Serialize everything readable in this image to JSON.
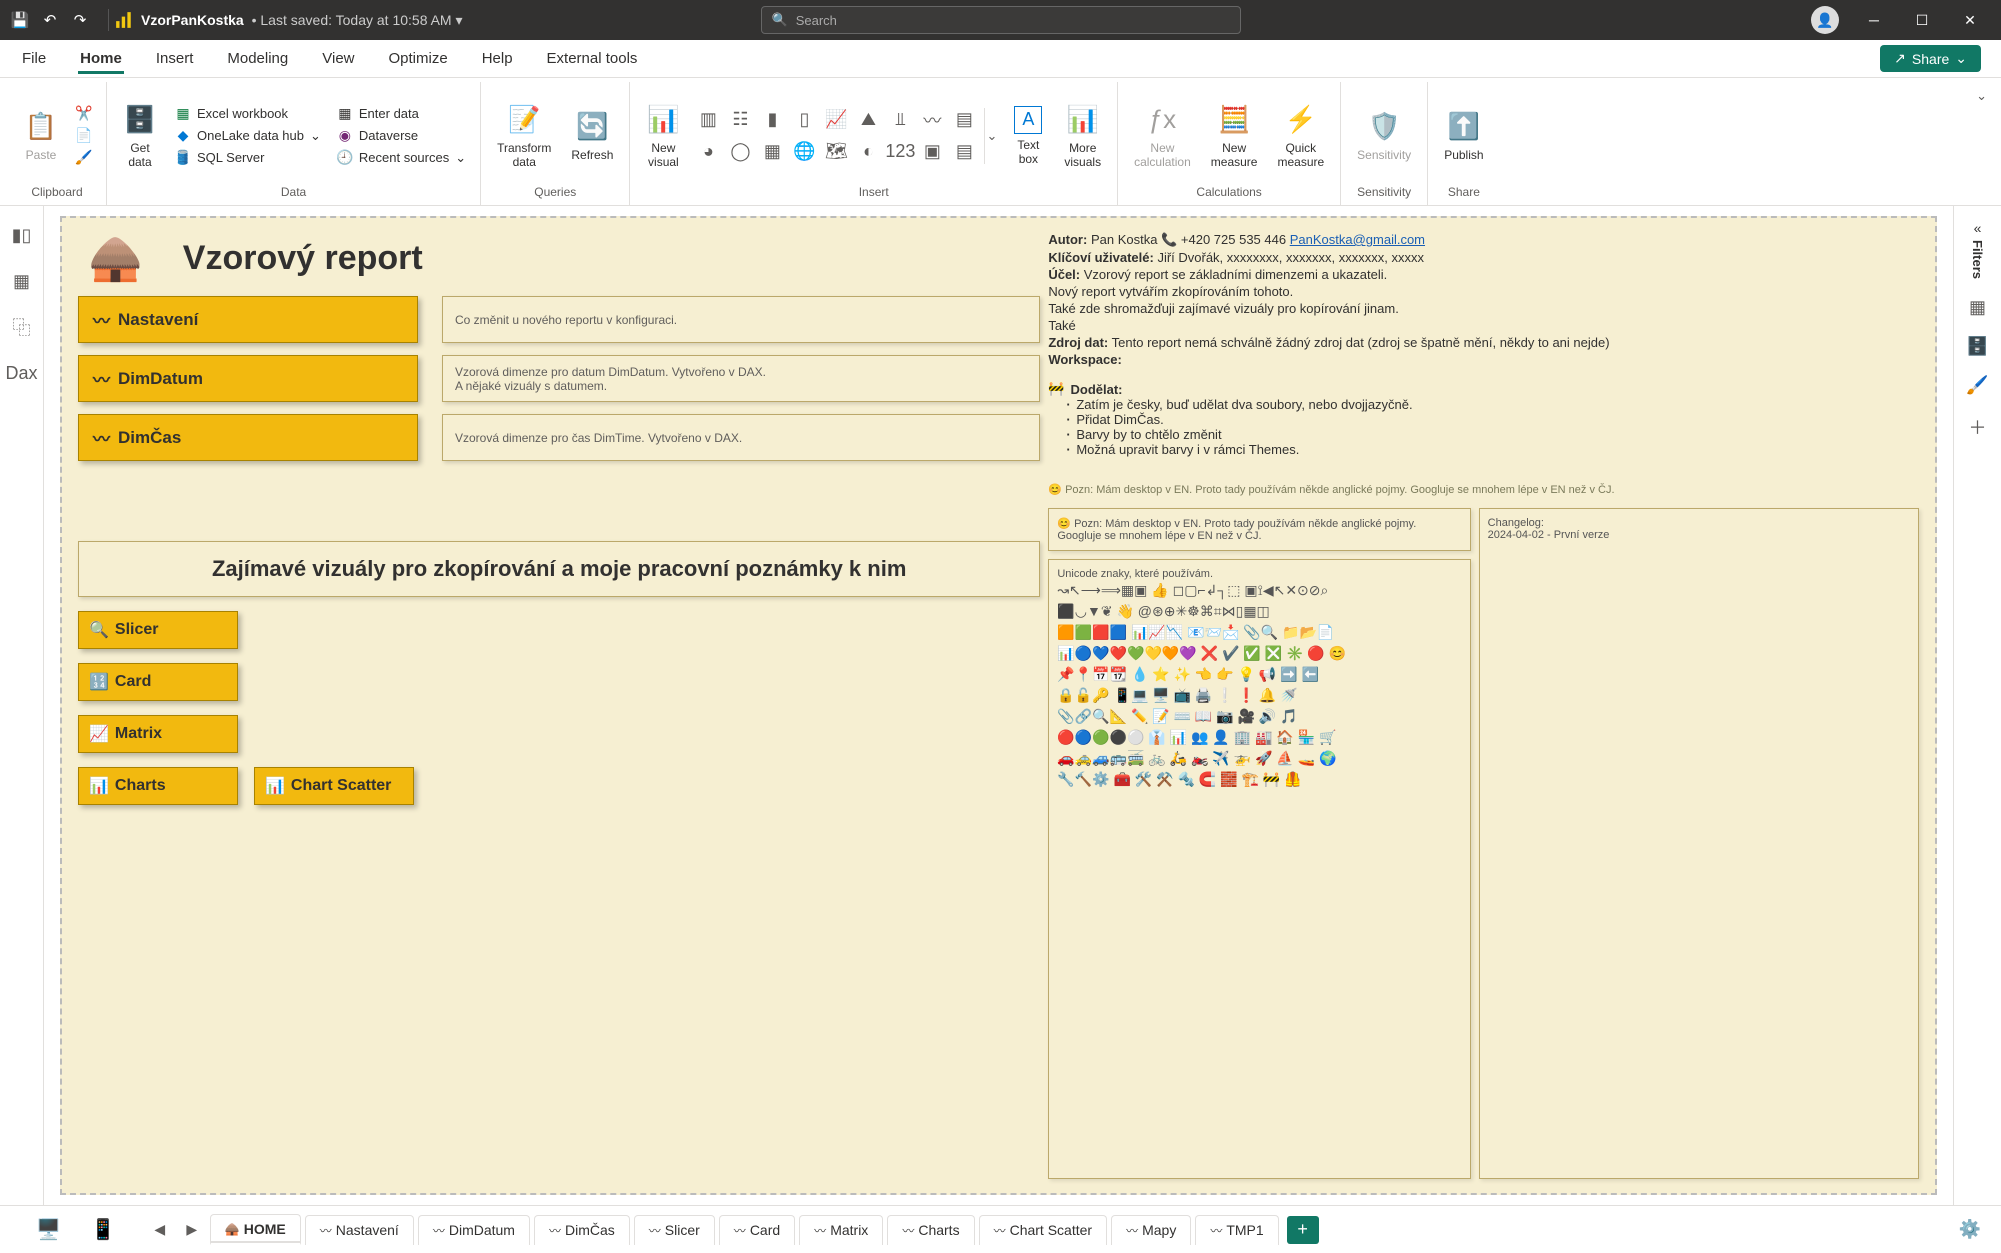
{
  "titlebar": {
    "filename": "VzorPanKostka",
    "saved": "Last saved: Today at 10:58 AM",
    "search_placeholder": "Search"
  },
  "tabs": [
    "File",
    "Home",
    "Insert",
    "Modeling",
    "View",
    "Optimize",
    "Help",
    "External tools"
  ],
  "share_label": "Share",
  "ribbon": {
    "clipboard": {
      "paste": "Paste",
      "label": "Clipboard"
    },
    "data": {
      "getdata": "Get\ndata",
      "mini": [
        "Excel workbook",
        "OneLake data hub",
        "SQL Server",
        "Enter data",
        "Dataverse",
        "Recent sources"
      ],
      "label": "Data"
    },
    "queries": {
      "transform": "Transform\ndata",
      "refresh": "Refresh",
      "label": "Queries"
    },
    "insert": {
      "newvisual": "New\nvisual",
      "textbox": "Text\nbox",
      "morevisuals": "More\nvisuals",
      "label": "Insert"
    },
    "calc": {
      "newcalc": "New\ncalculation",
      "newmeasure": "New\nmeasure",
      "quick": "Quick\nmeasure",
      "label": "Calculations"
    },
    "sensitivity": {
      "btn": "Sensitivity",
      "label": "Sensitivity"
    },
    "share": {
      "btn": "Publish",
      "label": "Share"
    }
  },
  "rightbar_filters": "Filters",
  "canvas": {
    "title": "Vzorový report",
    "nav": [
      {
        "label": "Nastavení",
        "desc": "Co změnit u nového reportu v konfiguraci."
      },
      {
        "label": "DimDatum",
        "desc": "Vzorová dimenze pro datum DimDatum. Vytvořeno v DAX.\nA nějaké vizuály s datumem."
      },
      {
        "label": "DimČas",
        "desc": "Vzorová dimenze pro čas DimTime. Vytvořeno v DAX."
      }
    ],
    "section": "Zajímavé vizuály pro zkopírování a moje pracovní poznámky k nim",
    "grid": [
      "Slicer",
      "Card",
      "Matrix",
      "Charts",
      "Chart Scatter"
    ],
    "info": {
      "autor_label": "Autor:",
      "autor": "Pan Kostka",
      "phone": "+420 725 535 446",
      "email": "PanKostka@gmail.com",
      "users_label": "Klíčoví uživatelé:",
      "users": "Jiří Dvořák, xxxxxxxx, xxxxxxx, xxxxxxx, xxxxx",
      "ucel_label": "Účel:",
      "ucel": "Vzorový report se základními dimenzemi a ukazateli.",
      "l1": "Nový report vytvářím zkopírováním tohoto.",
      "l2": "Také zde shromažďuji zajímavé vizuály pro kopírování jinam.",
      "l3": "Také",
      "zdroj_label": "Zdroj dat:",
      "zdroj": "Tento report nemá schválně žádný zdroj dat (zdroj se špatně mění, někdy to ani nejde)",
      "ws_label": "Workspace:",
      "todo_label": "Dodělat:",
      "todo": [
        "Zatím je česky, buď udělat dva soubory, nebo dvojjazyčně.",
        "Přidat DimČas.",
        "Barvy by to chtělo změnit",
        "Možná upravit barvy i v rámci Themes."
      ],
      "note": "😊 Pozn: Mám desktop v EN. Proto tady používám někde anglické pojmy.  Googluje se mnohem lépe v EN než v ČJ."
    },
    "box1": "😊 Pozn: Mám desktop v EN. Proto tady používám někde anglické pojmy.  Googluje se mnohem lépe v EN než v ČJ.",
    "box2_title": "Unicode znaky, které používám.",
    "box2_chars": "↝↖⟶⟹▦▣ 👍 ◻▢⌐↲┐⬚ ▣⟟◀↖✕⊙⊘⌕\n⬛◡▼❦ 👋 @⊛⊕✳☸⌘⌗⋈▯▦◫\n🟧🟩🟥🟦 📊📈📉 📧📨📩 📎🔍 📁📂📄\n📊🔵💙❤️💚💛🧡💜 ❌ ✔️ ✅ ❎ ✳️ 🔴 😊\n📌📍📅📆 💧 ⭐ ✨ 👈 👉 💡 📢 ➡️ ⬅️\n🔒🔓🔑 📱💻 🖥️ 📺 🖨️ ❕ ❗ 🔔 🚿\n📎🔗🔍📐 ✏️ 📝 ⌨️ 📖 📷 🎥 🔊 🎵\n🔴🔵🟢⚫⚪ 👔 📊 👥 👤 🏢 🏭 🏠 🏪 🛒\n🚗🚕🚙🚌🚎 🚲 🛵 🏍️ ✈️ 🚁 🚀 ⛵ 🚤 🌍\n🔧🔨⚙️ 🧰 🛠️ ⚒️ 🔩 🧲 🧱 🏗️ 🚧 🦺",
    "box3_title": "Changelog:",
    "box3_line": "2024-04-02 - První verze"
  },
  "pages": [
    "HOME",
    "Nastavení",
    "DimDatum",
    "DimČas",
    "Slicer",
    "Card",
    "Matrix",
    "Charts",
    "Chart Scatter",
    "Mapy",
    "TMP1"
  ]
}
